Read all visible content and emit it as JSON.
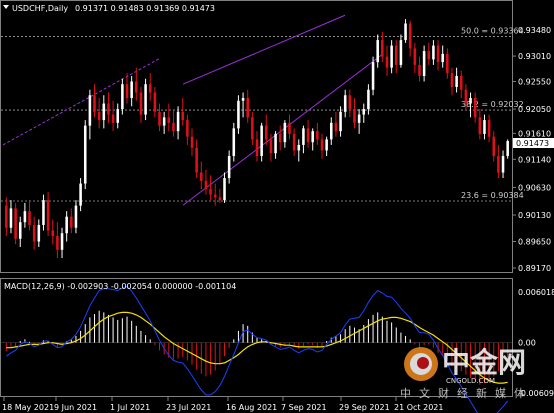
{
  "header": {
    "symbol": "USDCHF,Daily",
    "ohlc": "0.91371 0.91483 0.91369 0.91473",
    "dropdown_icon": "triangle-down-icon"
  },
  "macd_header": "MACD(12,26,9) -0.002903 -0.002054 0.000000 -0.001104",
  "price_axis": [
    "0.93480",
    "0.93010",
    "0.92550",
    "0.92050",
    "0.91610",
    "0.91140",
    "0.90630",
    "0.90130",
    "0.89650",
    "0.89170"
  ],
  "current_price": "0.91473",
  "macd_axis": [
    "0.006018",
    "0.00",
    "-0.006092"
  ],
  "date_axis": [
    "18 May 2021",
    "9 Jun 2021",
    "1 Jul 2021",
    "23 Jul 2021",
    "16 Aug 2021",
    "7 Sep 2021",
    "29 Sep 2021",
    "21 Oct 2021"
  ],
  "fibo_levels": [
    {
      "label": "50.0 = 0.93364",
      "price": 0.93364
    },
    {
      "label": "38.2 = 0.92032",
      "price": 0.92032
    },
    {
      "label": "23.6 = 0.90384",
      "price": 0.90384
    }
  ],
  "colors": {
    "bull": "#ffffff",
    "bear": "#e0101a",
    "channel": "#9b30d9",
    "macd_signal": "#f5e000",
    "macd_line": "#1d3fff"
  },
  "watermark": {
    "big": "中金网",
    "url": "CNGOLD.COM",
    "row": "中文财经新媒体",
    "logo_icon": "cngold-logo-icon"
  },
  "chart_data": {
    "type": "candlestick",
    "title": "USDCHF,Daily",
    "ylim": [
      0.8917,
      0.937
    ],
    "macd_ylim": [
      -0.006092,
      0.006018
    ],
    "candles": [
      [
        0.903,
        0.9045,
        0.8975,
        0.899
      ],
      [
        0.899,
        0.904,
        0.898,
        0.9025
      ],
      [
        0.9025,
        0.9035,
        0.896,
        0.897
      ],
      [
        0.897,
        0.901,
        0.8955,
        0.9
      ],
      [
        0.9,
        0.9035,
        0.899,
        0.902
      ],
      [
        0.902,
        0.904,
        0.8985,
        0.8995
      ],
      [
        0.8995,
        0.901,
        0.895,
        0.8965
      ],
      [
        0.8965,
        0.9005,
        0.8955,
        0.8995
      ],
      [
        0.8995,
        0.905,
        0.8985,
        0.904
      ],
      [
        0.904,
        0.9055,
        0.8975,
        0.8985
      ],
      [
        0.8985,
        0.9005,
        0.896,
        0.8975
      ],
      [
        0.8975,
        0.9,
        0.8935,
        0.895
      ],
      [
        0.895,
        0.899,
        0.8935,
        0.898
      ],
      [
        0.898,
        0.902,
        0.8965,
        0.901
      ],
      [
        0.901,
        0.9025,
        0.898,
        0.899
      ],
      [
        0.899,
        0.904,
        0.898,
        0.903
      ],
      [
        0.903,
        0.908,
        0.902,
        0.907
      ],
      [
        0.907,
        0.9185,
        0.906,
        0.9175
      ],
      [
        0.9175,
        0.924,
        0.915,
        0.923
      ],
      [
        0.923,
        0.925,
        0.919,
        0.92
      ],
      [
        0.92,
        0.9225,
        0.917,
        0.9185
      ],
      [
        0.9185,
        0.923,
        0.917,
        0.9215
      ],
      [
        0.9215,
        0.9235,
        0.918,
        0.9195
      ],
      [
        0.9195,
        0.922,
        0.9165,
        0.918
      ],
      [
        0.918,
        0.9215,
        0.917,
        0.9205
      ],
      [
        0.9205,
        0.926,
        0.9195,
        0.925
      ],
      [
        0.925,
        0.927,
        0.9215,
        0.9225
      ],
      [
        0.9225,
        0.9265,
        0.921,
        0.9255
      ],
      [
        0.9255,
        0.928,
        0.922,
        0.9235
      ],
      [
        0.9235,
        0.9245,
        0.918,
        0.9195
      ],
      [
        0.9195,
        0.926,
        0.9185,
        0.925
      ],
      [
        0.925,
        0.927,
        0.922,
        0.9235
      ],
      [
        0.9235,
        0.9245,
        0.919,
        0.92
      ],
      [
        0.92,
        0.9215,
        0.9165,
        0.9175
      ],
      [
        0.9175,
        0.92,
        0.916,
        0.919
      ],
      [
        0.919,
        0.9215,
        0.9165,
        0.918
      ],
      [
        0.918,
        0.9205,
        0.9155,
        0.9165
      ],
      [
        0.9165,
        0.921,
        0.915,
        0.92
      ],
      [
        0.92,
        0.9225,
        0.9175,
        0.9185
      ],
      [
        0.9185,
        0.9195,
        0.914,
        0.9155
      ],
      [
        0.9155,
        0.917,
        0.912,
        0.9135
      ],
      [
        0.9135,
        0.915,
        0.908,
        0.909
      ],
      [
        0.909,
        0.911,
        0.906,
        0.9075
      ],
      [
        0.9075,
        0.9095,
        0.905,
        0.906
      ],
      [
        0.906,
        0.9085,
        0.904,
        0.905
      ],
      [
        0.905,
        0.907,
        0.903,
        0.9045
      ],
      [
        0.9045,
        0.906,
        0.9035,
        0.904
      ],
      [
        0.904,
        0.909,
        0.9035,
        0.908
      ],
      [
        0.908,
        0.913,
        0.907,
        0.912
      ],
      [
        0.912,
        0.918,
        0.911,
        0.917
      ],
      [
        0.917,
        0.923,
        0.916,
        0.922
      ],
      [
        0.922,
        0.9235,
        0.919,
        0.9225
      ],
      [
        0.9225,
        0.924,
        0.918,
        0.919
      ],
      [
        0.919,
        0.92,
        0.914,
        0.915
      ],
      [
        0.915,
        0.9165,
        0.911,
        0.912
      ],
      [
        0.912,
        0.918,
        0.911,
        0.9175
      ],
      [
        0.9175,
        0.9195,
        0.914,
        0.915
      ],
      [
        0.915,
        0.916,
        0.911,
        0.9125
      ],
      [
        0.9125,
        0.9165,
        0.9115,
        0.916
      ],
      [
        0.916,
        0.9175,
        0.913,
        0.9145
      ],
      [
        0.9145,
        0.9185,
        0.9135,
        0.918
      ],
      [
        0.918,
        0.9195,
        0.915,
        0.916
      ],
      [
        0.916,
        0.917,
        0.912,
        0.913
      ],
      [
        0.913,
        0.915,
        0.911,
        0.914
      ],
      [
        0.914,
        0.9175,
        0.9125,
        0.917
      ],
      [
        0.917,
        0.9185,
        0.9135,
        0.9145
      ],
      [
        0.9145,
        0.917,
        0.913,
        0.9165
      ],
      [
        0.9165,
        0.918,
        0.914,
        0.915
      ],
      [
        0.915,
        0.916,
        0.9115,
        0.913
      ],
      [
        0.913,
        0.9155,
        0.912,
        0.915
      ],
      [
        0.915,
        0.919,
        0.914,
        0.918
      ],
      [
        0.918,
        0.92,
        0.9155,
        0.9165
      ],
      [
        0.9165,
        0.921,
        0.9155,
        0.92
      ],
      [
        0.92,
        0.924,
        0.919,
        0.923
      ],
      [
        0.923,
        0.924,
        0.919,
        0.9205
      ],
      [
        0.9205,
        0.9225,
        0.917,
        0.918
      ],
      [
        0.918,
        0.9205,
        0.916,
        0.9195
      ],
      [
        0.9195,
        0.9215,
        0.918,
        0.9205
      ],
      [
        0.9205,
        0.925,
        0.9195,
        0.924
      ],
      [
        0.924,
        0.93,
        0.923,
        0.929
      ],
      [
        0.929,
        0.934,
        0.928,
        0.933
      ],
      [
        0.933,
        0.9345,
        0.929,
        0.93
      ],
      [
        0.93,
        0.932,
        0.9265,
        0.928
      ],
      [
        0.928,
        0.933,
        0.927,
        0.932
      ],
      [
        0.932,
        0.933,
        0.927,
        0.9285
      ],
      [
        0.9285,
        0.934,
        0.928,
        0.933
      ],
      [
        0.933,
        0.9368,
        0.9325,
        0.936
      ],
      [
        0.936,
        0.9365,
        0.93,
        0.9315
      ],
      [
        0.9315,
        0.9325,
        0.927,
        0.9285
      ],
      [
        0.9285,
        0.93,
        0.9255,
        0.9265
      ],
      [
        0.9265,
        0.932,
        0.9255,
        0.931
      ],
      [
        0.931,
        0.9325,
        0.9285,
        0.9295
      ],
      [
        0.9295,
        0.933,
        0.9285,
        0.932
      ],
      [
        0.932,
        0.933,
        0.9275,
        0.929
      ],
      [
        0.929,
        0.932,
        0.928,
        0.9305
      ],
      [
        0.9305,
        0.9315,
        0.926,
        0.927
      ],
      [
        0.927,
        0.928,
        0.923,
        0.9245
      ],
      [
        0.9245,
        0.928,
        0.9235,
        0.9265
      ],
      [
        0.9265,
        0.9275,
        0.9225,
        0.924
      ],
      [
        0.924,
        0.925,
        0.9205,
        0.9215
      ],
      [
        0.9215,
        0.9235,
        0.919,
        0.9225
      ],
      [
        0.9225,
        0.9235,
        0.918,
        0.919
      ],
      [
        0.919,
        0.9205,
        0.915,
        0.916
      ],
      [
        0.916,
        0.9195,
        0.915,
        0.9185
      ],
      [
        0.9185,
        0.9195,
        0.9145,
        0.9155
      ],
      [
        0.9155,
        0.9165,
        0.911,
        0.912
      ],
      [
        0.912,
        0.914,
        0.908,
        0.909
      ],
      [
        0.909,
        0.913,
        0.908,
        0.912
      ],
      [
        0.912,
        0.915,
        0.9115,
        0.9147
      ]
    ],
    "macd_hist": [
      -0.001,
      -0.0006,
      -0.0004,
      0.0002,
      0.0004,
      0.0001,
      -0.0003,
      -0.0001,
      0.0003,
      0.0002,
      -0.0002,
      -0.0005,
      -0.0003,
      0.0002,
      0.0004,
      0.0008,
      0.0014,
      0.0022,
      0.003,
      0.0034,
      0.0038,
      0.0036,
      0.0033,
      0.003,
      0.0027,
      0.0029,
      0.0031,
      0.0026,
      0.002,
      0.0014,
      0.0009,
      0.0004,
      -0.0003,
      -0.0009,
      -0.0014,
      -0.0018,
      -0.002,
      -0.0019,
      -0.0017,
      -0.0021,
      -0.0026,
      -0.0032,
      -0.0037,
      -0.004,
      -0.0038,
      -0.0033,
      -0.0026,
      -0.0016,
      -0.0006,
      0.0004,
      0.0014,
      0.0022,
      0.002,
      0.0012,
      0.0006,
      0.0004,
      0.0002,
      -0.0002,
      -0.0004,
      -0.0006,
      -0.0004,
      -0.0002,
      -0.0005,
      -0.0007,
      -0.0004,
      -0.0002,
      -0.0003,
      -0.0006,
      -0.0004,
      0.0002,
      0.0006,
      0.0008,
      0.001,
      0.0016,
      0.002,
      0.0018,
      0.0016,
      0.0021,
      0.0028,
      0.0033,
      0.0036,
      0.0031,
      0.0026,
      0.0024,
      0.0018,
      0.0012,
      0.0008,
      0.0004,
      -0.0002,
      -0.0006,
      -0.0003,
      -0.0002,
      -0.0006,
      -0.0012,
      -0.0016,
      -0.0022,
      -0.0028,
      -0.003,
      -0.0034,
      -0.0038,
      -0.0042,
      -0.0046,
      -0.005,
      -0.0048,
      -0.0044,
      -0.004,
      -0.0034,
      -0.0028,
      -0.0022
    ],
    "macd_signal": [
      -0.0006,
      -0.0006,
      -0.0005,
      -0.0004,
      -0.0003,
      -0.0002,
      -0.0002,
      -0.0002,
      -0.0001,
      0.0,
      0.0,
      -0.0001,
      -0.0002,
      -0.0001,
      0.0,
      0.0002,
      0.0005,
      0.0009,
      0.0014,
      0.0019,
      0.0024,
      0.0028,
      0.0031,
      0.0033,
      0.0035,
      0.0036,
      0.0036,
      0.0035,
      0.0033,
      0.003,
      0.0026,
      0.0022,
      0.0017,
      0.0012,
      0.0007,
      0.0003,
      -0.0001,
      -0.0004,
      -0.0007,
      -0.001,
      -0.0013,
      -0.0016,
      -0.0019,
      -0.0022,
      -0.0024,
      -0.0025,
      -0.0025,
      -0.0024,
      -0.0021,
      -0.0018,
      -0.0014,
      -0.0009,
      -0.0005,
      -0.0002,
      0.0,
      0.0001,
      0.0001,
      0.0,
      -0.0001,
      -0.0002,
      -0.0003,
      -0.0003,
      -0.0004,
      -0.0005,
      -0.0005,
      -0.0005,
      -0.0005,
      -0.0005,
      -0.0005,
      -0.0004,
      -0.0002,
      0.0,
      0.0002,
      0.0005,
      0.0008,
      0.0011,
      0.0014,
      0.0017,
      0.002,
      0.0023,
      0.0026,
      0.0028,
      0.0029,
      0.003,
      0.003,
      0.0029,
      0.0027,
      0.0025,
      0.0022,
      0.0018,
      0.0015,
      0.0012,
      0.0009,
      0.0005,
      0.0001,
      -0.0003,
      -0.0008,
      -0.0013,
      -0.0018,
      -0.0023,
      -0.0028,
      -0.0033,
      -0.0038,
      -0.0042,
      -0.0045,
      -0.0047,
      -0.0048,
      -0.0048,
      -0.0047
    ]
  }
}
